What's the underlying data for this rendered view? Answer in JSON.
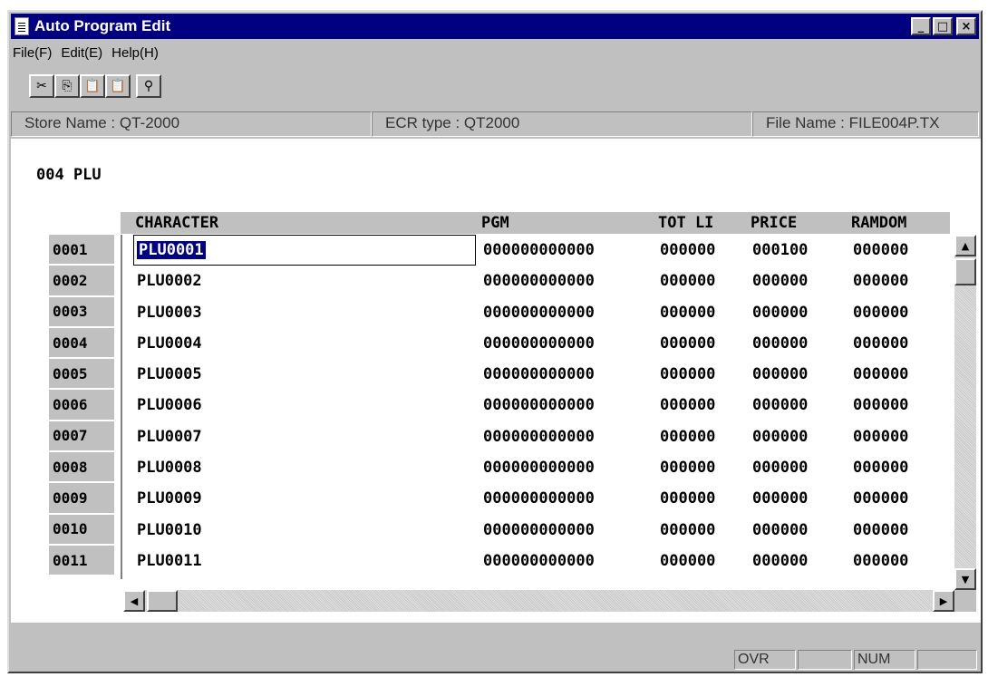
{
  "window": {
    "title": "Auto Program Edit",
    "controls": {
      "minimize": "_",
      "maximize": "□",
      "close": "×"
    }
  },
  "menu": [
    "File(F)",
    "Edit(E)",
    "Help(H)"
  ],
  "toolbar": [
    {
      "name": "cut",
      "glyph": "✂",
      "enabled": true
    },
    {
      "name": "copy",
      "glyph": "⎘",
      "enabled": true
    },
    {
      "name": "paste",
      "glyph": "📋",
      "enabled": false
    },
    {
      "name": "paste-special",
      "glyph": "📋",
      "enabled": false
    },
    {
      "name": "find",
      "glyph": "⚲",
      "enabled": true
    }
  ],
  "info": {
    "store": "Store Name : QT-2000",
    "ecr": "ECR type : QT2000",
    "file": "File Name : FILE004P.TX"
  },
  "section_title": "004 PLU",
  "columns": {
    "character": "CHARACTER",
    "pgm": "PGM",
    "tot": "TOT LI",
    "price": "PRICE",
    "random": "RAMDOM"
  },
  "rows": [
    {
      "num": "0001",
      "character": "PLU0001",
      "pgm": "000000000000",
      "tot": "000000",
      "price": "000100",
      "random": "000000"
    },
    {
      "num": "0002",
      "character": "PLU0002",
      "pgm": "000000000000",
      "tot": "000000",
      "price": "000000",
      "random": "000000"
    },
    {
      "num": "0003",
      "character": "PLU0003",
      "pgm": "000000000000",
      "tot": "000000",
      "price": "000000",
      "random": "000000"
    },
    {
      "num": "0004",
      "character": "PLU0004",
      "pgm": "000000000000",
      "tot": "000000",
      "price": "000000",
      "random": "000000"
    },
    {
      "num": "0005",
      "character": "PLU0005",
      "pgm": "000000000000",
      "tot": "000000",
      "price": "000000",
      "random": "000000"
    },
    {
      "num": "0006",
      "character": "PLU0006",
      "pgm": "000000000000",
      "tot": "000000",
      "price": "000000",
      "random": "000000"
    },
    {
      "num": "0007",
      "character": "PLU0007",
      "pgm": "000000000000",
      "tot": "000000",
      "price": "000000",
      "random": "000000"
    },
    {
      "num": "0008",
      "character": "PLU0008",
      "pgm": "000000000000",
      "tot": "000000",
      "price": "000000",
      "random": "000000"
    },
    {
      "num": "0009",
      "character": "PLU0009",
      "pgm": "000000000000",
      "tot": "000000",
      "price": "000000",
      "random": "000000"
    },
    {
      "num": "0010",
      "character": "PLU0010",
      "pgm": "000000000000",
      "tot": "000000",
      "price": "000000",
      "random": "000000"
    },
    {
      "num": "0011",
      "character": "PLU0011",
      "pgm": "000000000000",
      "tot": "000000",
      "price": "000000",
      "random": "000000"
    }
  ],
  "statusbar": {
    "ovr": "OVR",
    "num": "NUM"
  },
  "colors": {
    "titlebar": "#000080",
    "face": "#c0c0c0",
    "selection": "#000080"
  }
}
